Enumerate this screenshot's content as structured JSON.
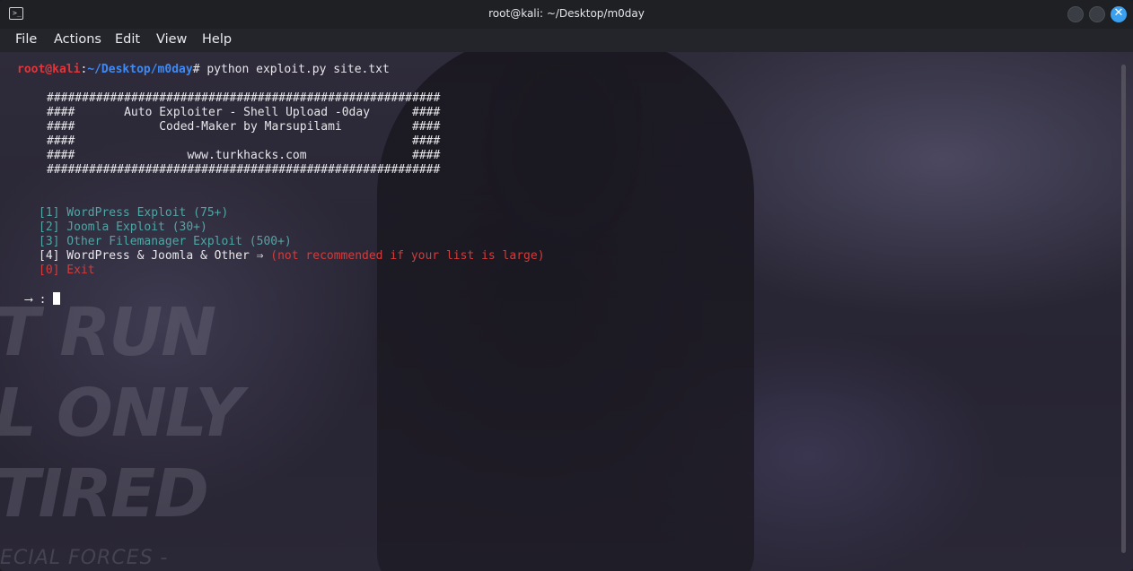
{
  "window": {
    "title": "root@kali: ~/Desktop/m0day"
  },
  "menu": {
    "file": "File",
    "actions": "Actions",
    "edit": "Edit",
    "view": "View",
    "help": "Help"
  },
  "prompt": {
    "user": "root@kali",
    "sep": ":",
    "path": "~/Desktop/m0day",
    "symbol": "#",
    "command": " python exploit.py site.txt"
  },
  "banner": {
    "border": "########################################################",
    "line1": "####       Auto Exploiter - Shell Upload -0day      ####",
    "line2": "####            Coded-Maker by Marsupilami          ####",
    "line3": "####                                                ####",
    "line4": "####                www.turkhacks.com               ####"
  },
  "options": [
    {
      "label": "[1] WordPress Exploit (75+)"
    },
    {
      "label": "[2] Joomla Exploit (30+)"
    },
    {
      "label": "[3] Other Filemanager Exploit (500+)"
    },
    {
      "label": "[4] WordPress & Joomla & Other ⇒",
      "note": " (not recommended if your list is large)"
    },
    {
      "label": "[0] Exit"
    }
  ],
  "input_prompt": "⟶ : ",
  "background_text": [
    "T RUN",
    "L ONLY",
    "TIRED",
    "ECIAL FORCES -"
  ],
  "colors": {
    "prompt_user": "#e0353b",
    "prompt_path": "#3d8af7",
    "option": "#4fa6a4",
    "warning": "#d23c3c",
    "close_button": "#3aa0f0"
  }
}
